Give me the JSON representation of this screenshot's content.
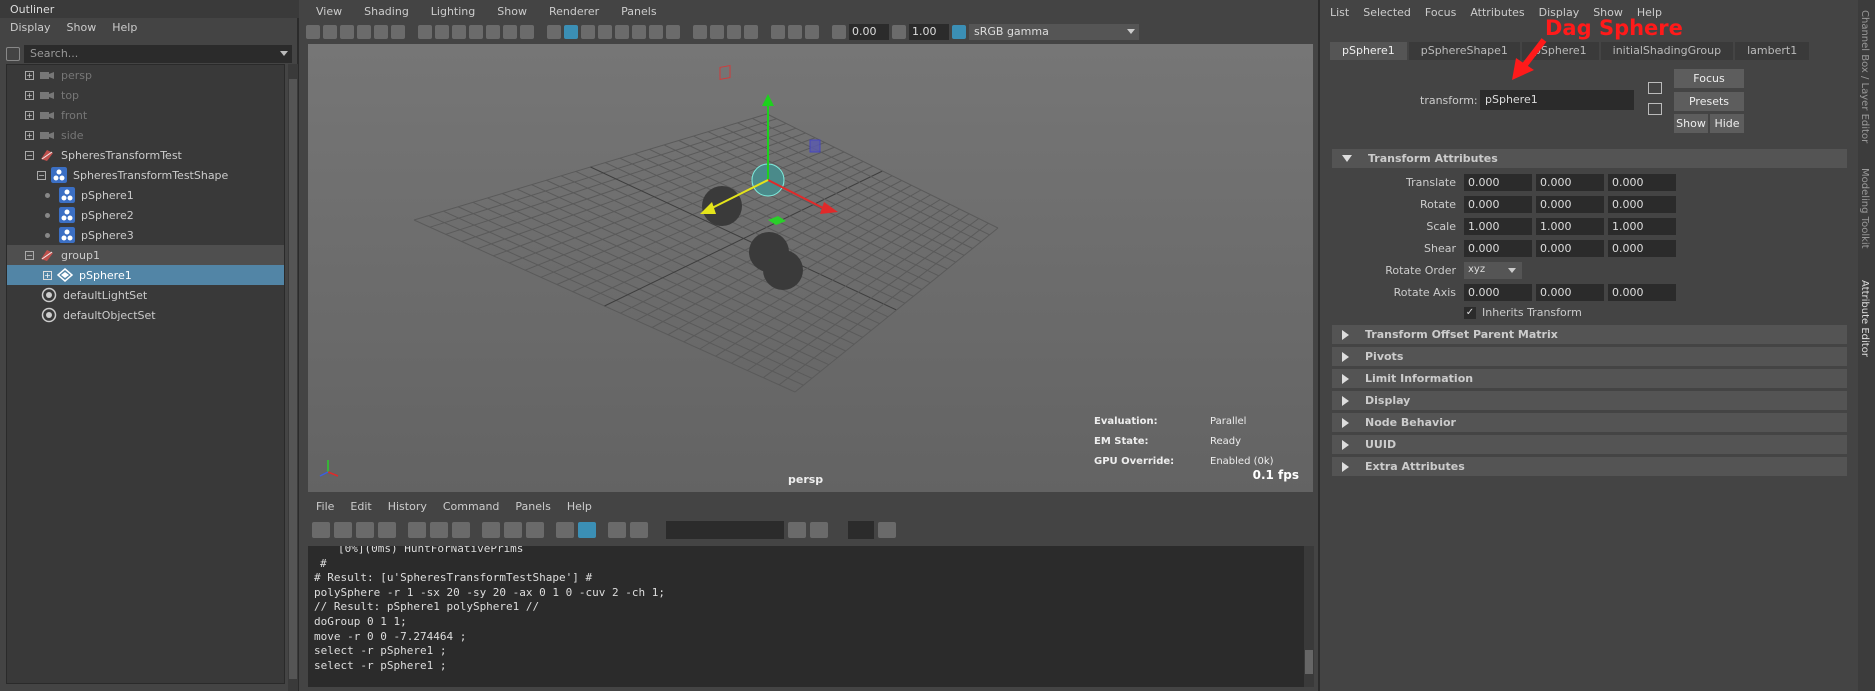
{
  "outliner": {
    "title": "Outliner",
    "menu": [
      "Display",
      "Show",
      "Help"
    ],
    "search_placeholder": "Search...",
    "items": [
      {
        "label": "persp",
        "icon": "camera-icon"
      },
      {
        "label": "top",
        "icon": "camera-icon"
      },
      {
        "label": "front",
        "icon": "camera-icon"
      },
      {
        "label": "side",
        "icon": "camera-icon"
      },
      {
        "label": "SpheresTransformTest",
        "icon": "transform-icon"
      },
      {
        "label": "SpheresTransformTestShape",
        "icon": "shape-icon"
      },
      {
        "label": "pSphere1",
        "icon": "shape-icon"
      },
      {
        "label": "pSphere2",
        "icon": "shape-icon"
      },
      {
        "label": "pSphere3",
        "icon": "shape-icon"
      },
      {
        "label": "group1",
        "icon": "transform-icon"
      },
      {
        "label": "pSphere1",
        "icon": "instance-icon"
      },
      {
        "label": "defaultLightSet",
        "icon": "set-icon"
      },
      {
        "label": "defaultObjectSet",
        "icon": "set-icon"
      }
    ]
  },
  "viewport": {
    "menu": [
      "View",
      "Shading",
      "Lighting",
      "Show",
      "Renderer",
      "Panels"
    ],
    "exposure": "0.00",
    "gamma": "1.00",
    "color_space": "sRGB gamma",
    "camera": "persp",
    "hud": [
      {
        "key": "Evaluation:",
        "value": "Parallel"
      },
      {
        "key": "EM State:",
        "value": "Ready"
      },
      {
        "key": "GPU Override:",
        "value": "Enabled (0k)"
      }
    ],
    "fps": "0.1 fps"
  },
  "script_editor": {
    "menu": [
      "File",
      "Edit",
      "History",
      "Command",
      "Panels",
      "Help"
    ],
    "lines": [
      "[0%](0ms) HuntForNativePrims",
      "#",
      "# Result: [u'SpheresTransformTestShape'] #",
      "polySphere -r 1 -sx 20 -sy 20 -ax 0 1 0 -cuv 2 -ch 1;",
      "// Result: pSphere1 polySphere1 //",
      "doGroup 0 1 1;",
      "move -r 0 0 -7.274464 ;",
      "select -r pSphere1 ;",
      "select -r pSphere1 ;"
    ]
  },
  "attribute_editor": {
    "menu": [
      "List",
      "Selected",
      "Focus",
      "Attributes",
      "Display",
      "Show",
      "Help"
    ],
    "tabs": [
      "pSphere1",
      "pSphereShape1",
      "pSphere1",
      "initialShadingGroup",
      "lambert1"
    ],
    "annotation": "Dag Sphere",
    "transform_label": "transform:",
    "transform_value": "pSphere1",
    "buttons": {
      "focus": "Focus",
      "presets": "Presets",
      "show": "Show",
      "hide": "Hide"
    },
    "section_transform": "Transform Attributes",
    "attrs": {
      "translate": {
        "label": "Translate",
        "values": [
          "0.000",
          "0.000",
          "0.000"
        ]
      },
      "rotate": {
        "label": "Rotate",
        "values": [
          "0.000",
          "0.000",
          "0.000"
        ]
      },
      "scale": {
        "label": "Scale",
        "values": [
          "1.000",
          "1.000",
          "1.000"
        ]
      },
      "shear": {
        "label": "Shear",
        "values": [
          "0.000",
          "0.000",
          "0.000"
        ]
      },
      "rotate_order": {
        "label": "Rotate Order",
        "value": "xyz"
      },
      "rotate_axis": {
        "label": "Rotate Axis",
        "values": [
          "0.000",
          "0.000",
          "0.000"
        ]
      }
    },
    "inherits_transform": "Inherits Transform",
    "sections": [
      "Transform Offset Parent Matrix",
      "Pivots",
      "Limit Information",
      "Display",
      "Node Behavior",
      "UUID",
      "Extra Attributes"
    ],
    "side_tabs": [
      "Channel Box / Layer Editor",
      "Modeling Toolkit",
      "Attribute Editor"
    ]
  }
}
